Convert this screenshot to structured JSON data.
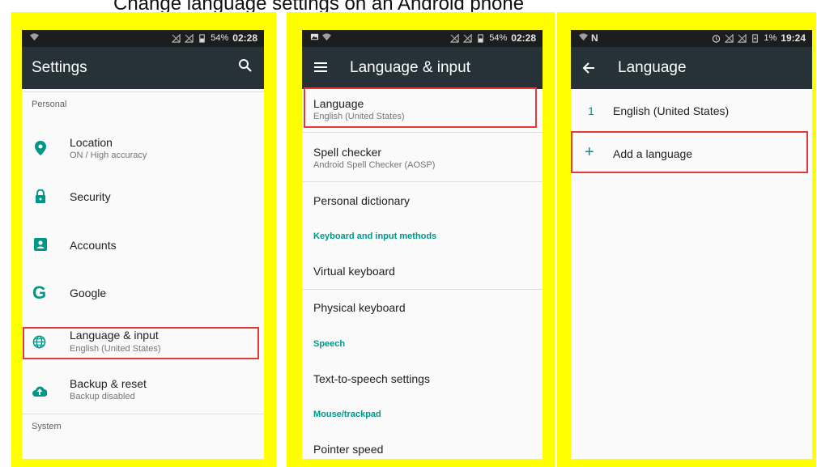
{
  "caption": "Change language settings on an Android phone",
  "screen1": {
    "status": {
      "battery": "54%",
      "time": "02:28"
    },
    "title": "Settings",
    "personal_header": "Personal",
    "items": [
      {
        "title": "Location",
        "subtitle": "ON / High accuracy",
        "icon": "location-pin-icon"
      },
      {
        "title": "Security",
        "subtitle": "",
        "icon": "lock-icon"
      },
      {
        "title": "Accounts",
        "subtitle": "",
        "icon": "account-box-icon"
      },
      {
        "title": "Google",
        "subtitle": "",
        "icon": "google-icon"
      },
      {
        "title": "Language & input",
        "subtitle": "English (United States)",
        "icon": "globe-icon"
      },
      {
        "title": "Backup & reset",
        "subtitle": "Backup disabled",
        "icon": "cloud-upload-icon"
      }
    ],
    "system_header": "System"
  },
  "screen2": {
    "status": {
      "battery": "54%",
      "time": "02:28"
    },
    "title": "Language & input",
    "language": {
      "title": "Language",
      "subtitle": "English (United States)"
    },
    "spell_checker": {
      "title": "Spell checker",
      "subtitle": "Android Spell Checker (AOSP)"
    },
    "personal_dictionary": "Personal dictionary",
    "keyboard_header": "Keyboard and input methods",
    "virtual_keyboard": "Virtual keyboard",
    "physical_keyboard": "Physical keyboard",
    "speech_header": "Speech",
    "tts": "Text-to-speech settings",
    "mouse_header": "Mouse/trackpad",
    "pointer_speed": "Pointer speed"
  },
  "screen3": {
    "status": {
      "battery": "1%",
      "time": "19:24"
    },
    "title": "Language",
    "languages": [
      {
        "index": "1",
        "name": "English (United States)"
      }
    ],
    "add_symbol": "+",
    "add_label": "Add a language"
  },
  "colors": {
    "accent": "#009688",
    "appbar": "#263238",
    "statusbar": "#1b1d1f",
    "highlight": "#e53935",
    "frame": "#ffff00"
  }
}
